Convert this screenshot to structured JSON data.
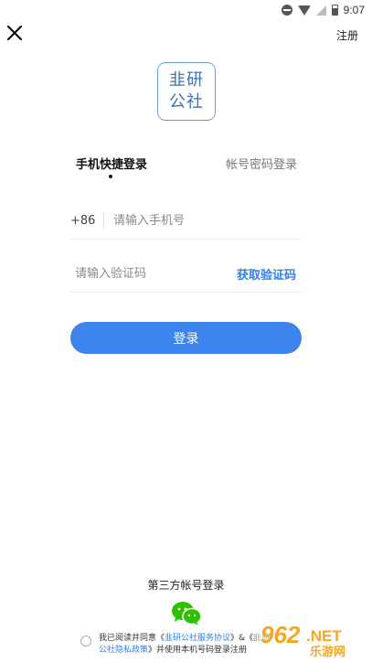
{
  "status_bar": {
    "time": "9:07"
  },
  "header": {
    "register_label": "注册"
  },
  "logo": {
    "line1": "韭研",
    "line2": "公社"
  },
  "tabs": {
    "phone_login": "手机快捷登录",
    "account_login": "帐号密码登录"
  },
  "phone_field": {
    "country_code": "+86",
    "placeholder": "请输入手机号"
  },
  "code_field": {
    "placeholder": "请输入验证码",
    "get_code_label": "获取验证码"
  },
  "login_button": {
    "label": "登录"
  },
  "third_party": {
    "label": "第三方帐号登录"
  },
  "agreement": {
    "prefix": "我已阅读并同意《",
    "service_link": "韭研公社服务协议",
    "middle": "》&《韭",
    "privacy_link": "研公社隐私政策",
    "suffix": "》并使用本机号码登录注册"
  },
  "watermark": {
    "text1": "962",
    "text2": ".NET",
    "text3": "乐游网"
  },
  "colors": {
    "accent": "#3d84ee",
    "link": "#2e7fe6",
    "wechat": "#2dc100",
    "watermark": "#f5a623"
  }
}
